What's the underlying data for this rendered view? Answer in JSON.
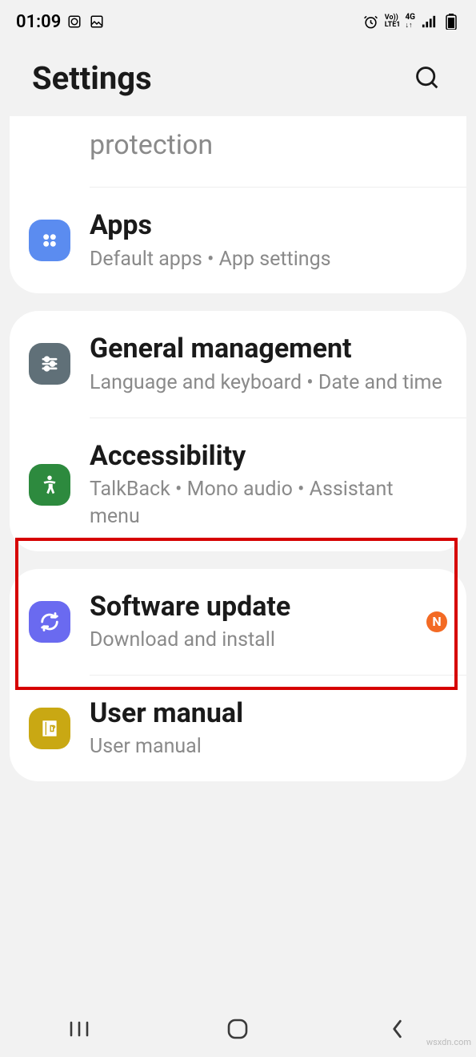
{
  "status": {
    "time": "01:09",
    "volte": "Vo))",
    "lte": "LTE1",
    "network": "4G"
  },
  "header": {
    "title": "Settings"
  },
  "card1": {
    "truncated_title": "protection",
    "apps": {
      "title": "Apps",
      "sub": "Default apps  •  App settings"
    }
  },
  "card2": {
    "general": {
      "title": "General management",
      "sub": "Language and keyboard  •  Date and time"
    },
    "accessibility": {
      "title": "Accessibility",
      "sub": "TalkBack  •  Mono audio  •  Assistant menu"
    }
  },
  "card3": {
    "software": {
      "title": "Software update",
      "sub": "Download and install",
      "badge": "N"
    },
    "manual": {
      "title": "User manual",
      "sub": "User manual"
    }
  },
  "watermark": "wsxdn.com"
}
